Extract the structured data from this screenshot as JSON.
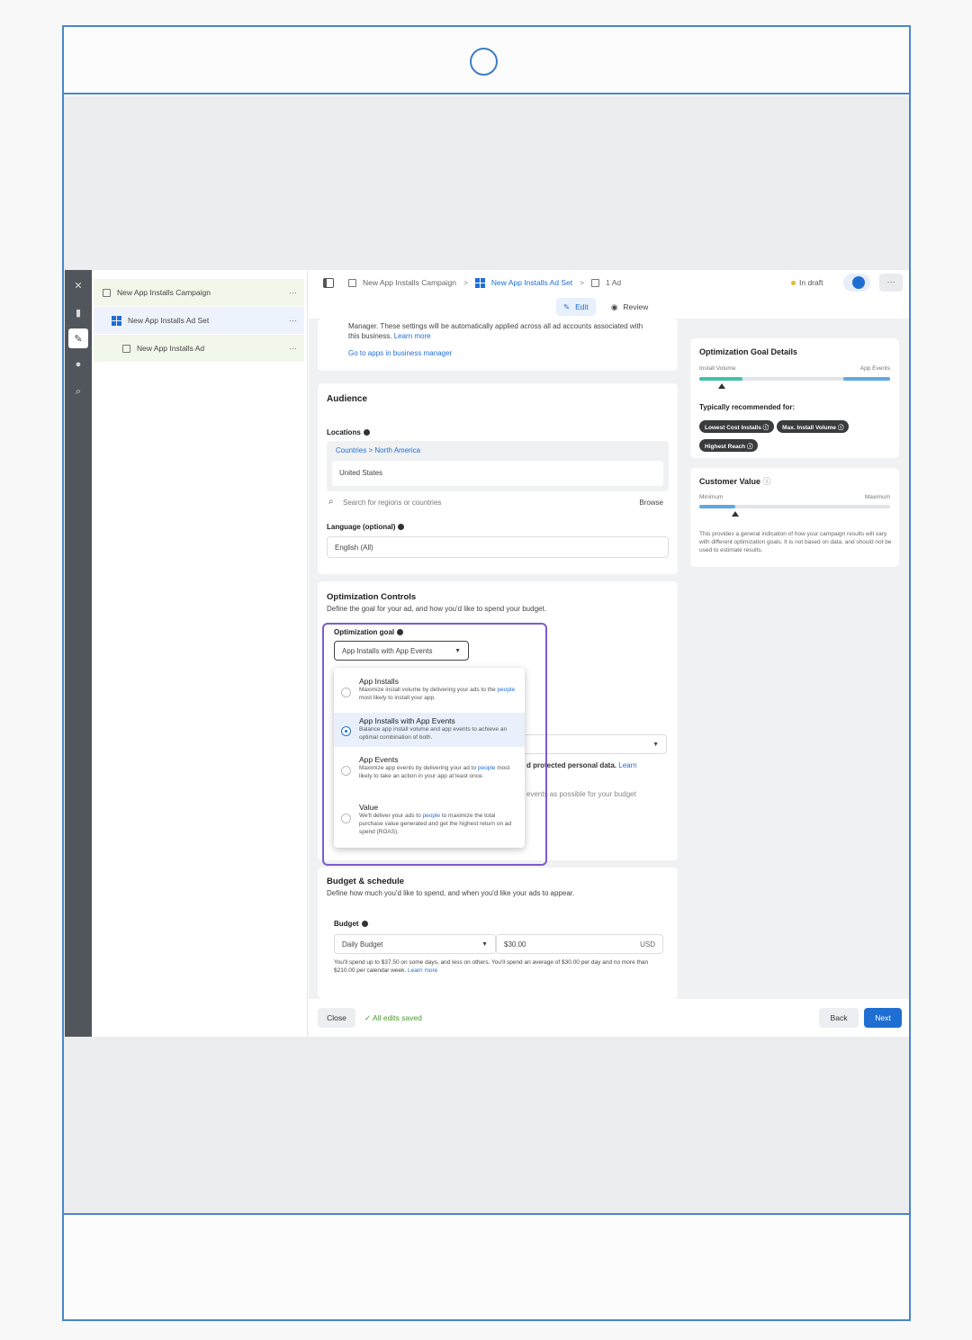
{
  "tree": {
    "campaign": "New App Installs Campaign",
    "adset": "New App Installs Ad Set",
    "ad": "New App Installs Ad",
    "more": "···"
  },
  "breadcrumb": {
    "campaign": "New App Installs Campaign",
    "adset": "New App Installs Ad Set",
    "ad": "1 Ad",
    "sep": ">"
  },
  "status": "In draft",
  "more_label": "···",
  "tabs": {
    "edit": "Edit",
    "review": "Review"
  },
  "manager_card": {
    "text": "Manager. These settings will be automatically applied across all ad accounts associated with this business.",
    "learn_more": "Learn more",
    "link": "Go to apps in business manager"
  },
  "audience": {
    "title": "Audience",
    "locations_label": "Locations",
    "locations_path": "Countries > North America",
    "location_value": "United States",
    "search_placeholder": "Search for regions or countries",
    "browse": "Browse",
    "language_label": "Language (optional)",
    "language_value": "English (All)"
  },
  "optimization": {
    "title": "Optimization Controls",
    "subtitle": "Define the goal for your ad, and how you'd like to spend your budget.",
    "goal_label": "Optimization goal",
    "selected": "App Installs with App Events",
    "options": [
      {
        "title": "App Installs",
        "desc_pre": "Maximize install volume by delivering your ads to the ",
        "desc_link": "people",
        "desc_post": " most likely to install your app."
      },
      {
        "title": "App Installs with App Events",
        "desc_pre": "Balance app install volume and app events to achieve an optimal combination of both.",
        "desc_link": "",
        "desc_post": ""
      },
      {
        "title": "App Events",
        "desc_pre": "Maximize app events by delivering your ad to ",
        "desc_link": "people",
        "desc_post": " most likely to take an action in your app at least once."
      },
      {
        "title": "Value",
        "desc_pre": "We'll deliver your ads to ",
        "desc_link": "people",
        "desc_post": " to maximize the total purchase value generated and get the highest return on ad spend (ROAS)."
      }
    ],
    "hidden_text_1": "d protected personal data.",
    "hidden_link_1": "Learn",
    "hidden_text_2": "events as possible for your budget"
  },
  "budget": {
    "title": "Budget & schedule",
    "subtitle": "Define how much you'd like to spend, and when you'd like your ads to appear.",
    "label": "Budget",
    "type": "Daily Budget",
    "amount": "$30.00",
    "currency": "USD",
    "note": "You'll spend up to $37.50 on some days, and less on others. You'll spend an average of $30.00 per day and no more than $210.00 per calendar week.",
    "learn_more": "Learn more"
  },
  "goal_details": {
    "title": "Optimization Goal Details",
    "left": "Install Volume",
    "right": "App Events",
    "recommended_label": "Typically recommended for:",
    "pills": [
      "Lowest Cost Installs",
      "Max. Install Volume",
      "Highest Reach"
    ],
    "position": 0.12
  },
  "customer_value": {
    "title": "Customer Value",
    "left": "Minimum",
    "right": "Maximum",
    "desc": "This provides a general indication of how your campaign results will vary with different optimization goals. It is not based on data, and should not be used to estimate results.",
    "position": 0.19
  },
  "footer": {
    "close": "Close",
    "saved": "All edits saved",
    "back": "Back",
    "next": "Next"
  },
  "colors": {
    "accent": "#1f6fd3",
    "frame": "#4a86c9",
    "menu_outline": "#7d5bd0",
    "status_draft": "#e7b52c",
    "slider_green": "#41c2a9",
    "slider_blue": "#5fa8e2"
  }
}
